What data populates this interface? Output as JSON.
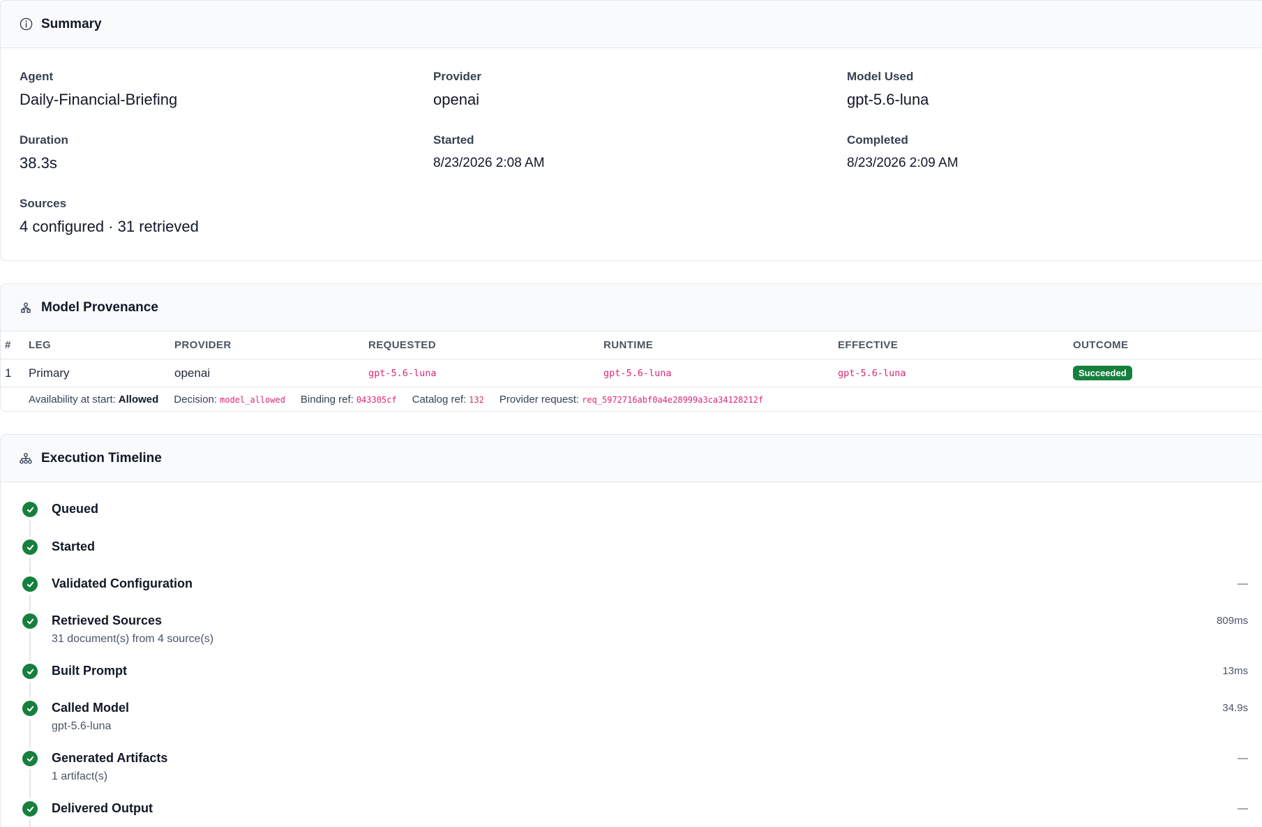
{
  "summary": {
    "title": "Summary",
    "icon": "info-icon",
    "agent_label": "Agent",
    "agent_value": "Daily-Financial-Briefing",
    "provider_label": "Provider",
    "provider_value": "openai",
    "model_label": "Model Used",
    "model_value": "gpt-5.6-luna",
    "duration_label": "Duration",
    "duration_value": "38.3s",
    "started_label": "Started",
    "started_value": "8/23/2026 2:08 AM",
    "completed_label": "Completed",
    "completed_value": "8/23/2026 2:09 AM",
    "sources_label": "Sources",
    "sources_value": "4 configured · 31 retrieved"
  },
  "provenance": {
    "title": "Model Provenance",
    "icon": "provenance-icon",
    "headers": [
      "#",
      "LEG",
      "PROVIDER",
      "REQUESTED",
      "RUNTIME",
      "EFFECTIVE",
      "OUTCOME"
    ],
    "row": {
      "num": "1",
      "leg": "Primary",
      "provider": "openai",
      "requested": "gpt-5.6-luna",
      "runtime": "gpt-5.6-luna",
      "effective": "gpt-5.6-luna",
      "outcome": "Succeeded"
    },
    "meta": {
      "availability_label": "Availability at start:",
      "availability_value": "Allowed",
      "decision_label": "Decision:",
      "decision_value": "model_allowed",
      "binding_label": "Binding ref:",
      "binding_value": "043305cf",
      "catalog_label": "Catalog ref:",
      "catalog_value": "132",
      "request_label": "Provider request:",
      "request_value": "req_5972716abf0a4e28999a3ca34128212f"
    },
    "colors": {
      "success": "#15803d",
      "code": "#db2777"
    }
  },
  "timeline": {
    "title": "Execution Timeline",
    "icon": "sitemap-icon",
    "steps": [
      {
        "title": "Queued",
        "sub": "",
        "duration": ""
      },
      {
        "title": "Started",
        "sub": "",
        "duration": ""
      },
      {
        "title": "Validated Configuration",
        "sub": "",
        "duration": "—"
      },
      {
        "title": "Retrieved Sources",
        "sub": "31 document(s) from 4 source(s)",
        "duration": "809ms"
      },
      {
        "title": "Built Prompt",
        "sub": "",
        "duration": "13ms"
      },
      {
        "title": "Called Model",
        "sub": "gpt-5.6-luna",
        "duration": "34.9s"
      },
      {
        "title": "Generated Artifacts",
        "sub": "1 artifact(s)",
        "duration": "—"
      },
      {
        "title": "Delivered Output",
        "sub": "",
        "duration": "—"
      }
    ]
  }
}
